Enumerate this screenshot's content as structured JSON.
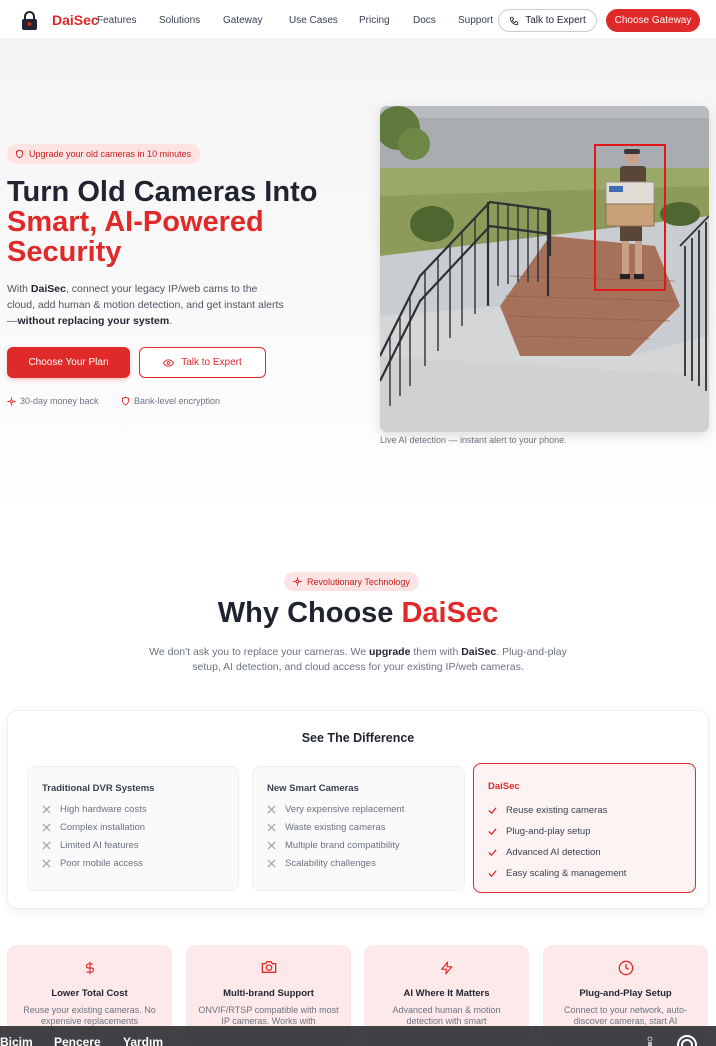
{
  "brand": {
    "name": "DaiSec",
    "accent": "#e02a2a"
  },
  "nav": {
    "links": [
      "Features",
      "Solutions",
      "Gateway",
      "Use Cases",
      "Pricing",
      "Docs",
      "Support"
    ],
    "talk_label": "Talk to Expert",
    "cta_label": "Choose Gateway"
  },
  "hero": {
    "badge": "Upgrade your old cameras in 10 minutes",
    "title_line1": "Turn Old Cameras Into",
    "title_line2": "Smart, AI-Powered",
    "title_line3": "Security",
    "desc_prefix": "With ",
    "desc_brand": "DaiSec",
    "desc_body": ", connect your legacy IP/web cams to the cloud, add human & motion detection, and get instant alerts—",
    "desc_bold": "without replacing your system",
    "desc_suffix": ".",
    "primary_btn": "Choose Your Plan",
    "secondary_btn": "Talk to Expert",
    "trust1": "30-day money back",
    "trust2": "Bank-level encryption",
    "image_caption": "Live AI detection — instant alert to your phone."
  },
  "why": {
    "badge": "Revolutionary Technology",
    "title_prefix": "Why Choose ",
    "title_brand": "DaiSec",
    "desc_part1": "We don't ask you to replace your cameras. We ",
    "desc_bold": "upgrade",
    "desc_part2": " them with ",
    "desc_brand": "DaiSec",
    "desc_part3": ". Plug-and-play setup, AI detection, and cloud access for your existing IP/web cameras.",
    "diff_title": "See The Difference",
    "columns": [
      {
        "head": "Traditional DVR Systems",
        "items": [
          "High hardware costs",
          "Complex installation",
          "Limited AI features",
          "Poor mobile access"
        ]
      },
      {
        "head": "New Smart Cameras",
        "items": [
          "Very expensive replacement",
          "Waste existing cameras",
          "Multiple brand compatibility",
          "Scalability challenges"
        ]
      },
      {
        "head": "DaiSec",
        "items": [
          "Reuse existing cameras",
          "Plug-and-play setup",
          "Advanced AI detection",
          "Easy scaling & management"
        ]
      }
    ]
  },
  "features": [
    {
      "icon": "dollar-icon",
      "title": "Lower Total Cost",
      "desc": "Reuse your existing cameras. No expensive replacements"
    },
    {
      "icon": "camera-icon",
      "title": "Multi-brand Support",
      "desc": "ONVIF/RTSP compatible with most IP cameras. Works with"
    },
    {
      "icon": "lightning-icon",
      "title": "AI Where It Matters",
      "desc": "Advanced human & motion detection with smart"
    },
    {
      "icon": "clock-icon",
      "title": "Plug-and-Play Setup",
      "desc": "Connect to your network, auto-discover cameras, start AI"
    }
  ],
  "osbar": {
    "items": [
      "Biçim",
      "Pencere",
      "Yardım"
    ]
  }
}
